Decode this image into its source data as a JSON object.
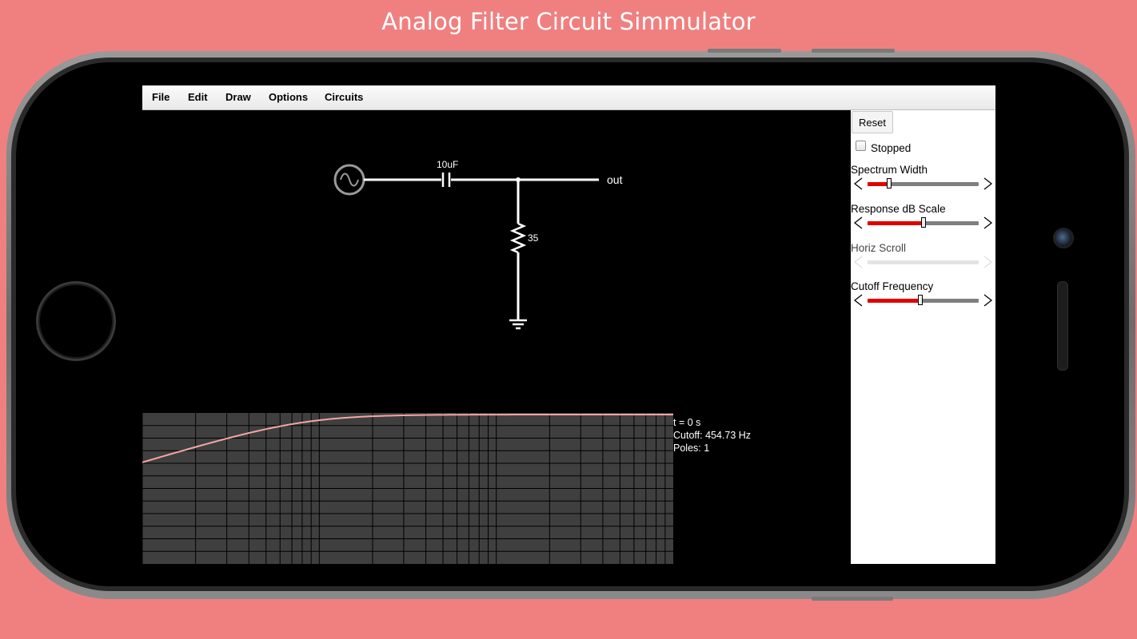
{
  "banner": {
    "title": "Analog Filter Circuit Simmulator"
  },
  "menu": {
    "items": [
      "File",
      "Edit",
      "Draw",
      "Options",
      "Circuits"
    ]
  },
  "circuit": {
    "capacitor_label": "10uF",
    "resistor_label": "35",
    "output_label": "out"
  },
  "sidebar": {
    "reset_label": "Reset",
    "stopped_label": "Stopped",
    "stopped_checked": false,
    "sliders": [
      {
        "label": "Spectrum Width",
        "value": 0.2,
        "enabled": true
      },
      {
        "label": "Response dB Scale",
        "value": 0.51,
        "enabled": true
      },
      {
        "label": "Horiz Scroll",
        "value": 0,
        "enabled": false
      },
      {
        "label": "Cutoff Frequency",
        "value": 0.48,
        "enabled": true
      }
    ]
  },
  "scope": {
    "time_text": "t = 0 s",
    "cutoff_text": "Cutoff: 454.73 Hz",
    "poles_text": "Poles: 1"
  },
  "colors": {
    "background": "#f08080",
    "plot_bg": "#3f3f3f",
    "plot_grid": "#000000",
    "response_curve": "#f4a6a6",
    "slider_fill": "#e00000",
    "wire": "#ffffff",
    "source": "#9a9a9a"
  }
}
